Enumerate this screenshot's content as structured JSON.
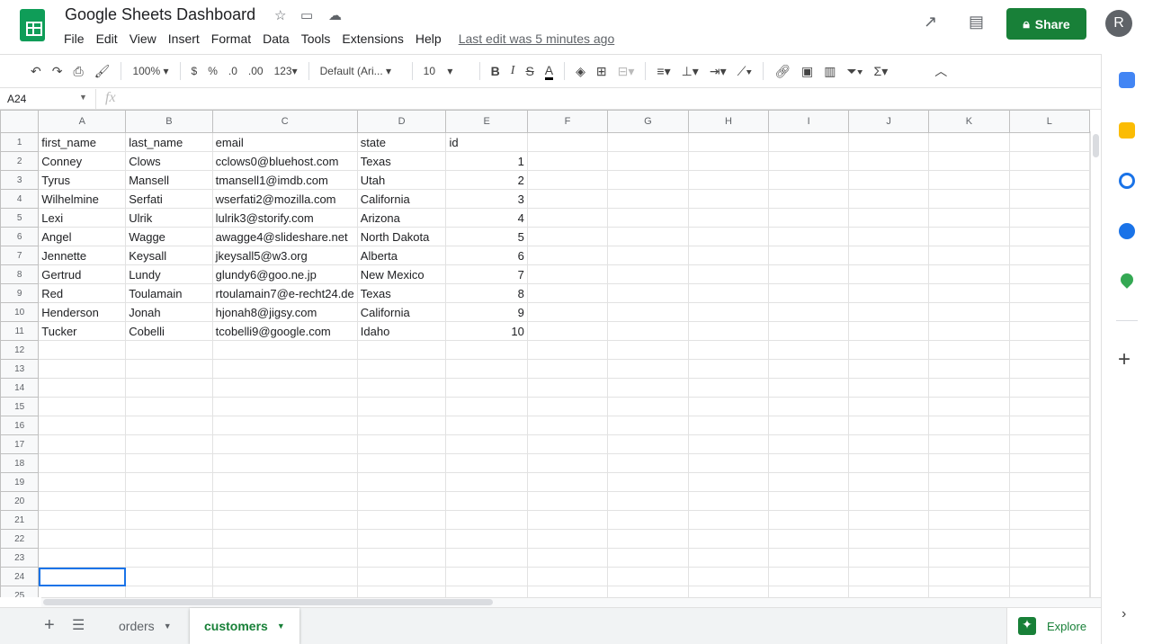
{
  "app": {
    "title": "Google Sheets Dashboard",
    "last_edit": "Last edit was 5 minutes ago",
    "share_label": "Share",
    "avatar_initial": "R"
  },
  "menu": [
    "File",
    "Edit",
    "View",
    "Insert",
    "Format",
    "Data",
    "Tools",
    "Extensions",
    "Help"
  ],
  "toolbar": {
    "zoom": "100%",
    "currency": "$",
    "percent": "%",
    "dec_decrease": ".0",
    "dec_increase": ".00",
    "number_format": "123",
    "font": "Default (Ari...",
    "font_size": "10",
    "bold": "B",
    "italic": "I",
    "strike": "S",
    "text_color": "A"
  },
  "formula_bar": {
    "cell_ref": "A24",
    "fx": "fx",
    "value": ""
  },
  "columns": [
    "A",
    "B",
    "C",
    "D",
    "E",
    "F",
    "G",
    "H",
    "I",
    "J",
    "K",
    "L"
  ],
  "rows": [
    [
      "first_name",
      "last_name",
      "email",
      "state",
      "id"
    ],
    [
      "Conney",
      "Clows",
      "cclows0@bluehost.com",
      "Texas",
      "1"
    ],
    [
      "Tyrus",
      "Mansell",
      "tmansell1@imdb.com",
      "Utah",
      "2"
    ],
    [
      "Wilhelmine",
      "Serfati",
      "wserfati2@mozilla.com",
      "California",
      "3"
    ],
    [
      "Lexi",
      "Ulrik",
      "lulrik3@storify.com",
      "Arizona",
      "4"
    ],
    [
      "Angel",
      "Wagge",
      "awagge4@slideshare.net",
      "North Dakota",
      "5"
    ],
    [
      "Jennette",
      "Keysall",
      "jkeysall5@w3.org",
      "Alberta",
      "6"
    ],
    [
      "Gertrud",
      "Lundy",
      "glundy6@goo.ne.jp",
      "New Mexico",
      "7"
    ],
    [
      "Red",
      "Toulamain",
      "rtoulamain7@e-recht24.de",
      "Texas",
      "8"
    ],
    [
      "Henderson",
      "Jonah",
      "hjonah8@jigsy.com",
      "California",
      "9"
    ],
    [
      "Tucker",
      "Cobelli",
      "tcobelli9@google.com",
      "Idaho",
      "10"
    ]
  ],
  "total_rows": 25,
  "selected_cell": "A24",
  "sheets": [
    {
      "name": "orders",
      "active": false
    },
    {
      "name": "customers",
      "active": true
    }
  ],
  "explore_label": "Explore",
  "colors": {
    "accent": "#188038",
    "selection": "#1a73e8"
  }
}
